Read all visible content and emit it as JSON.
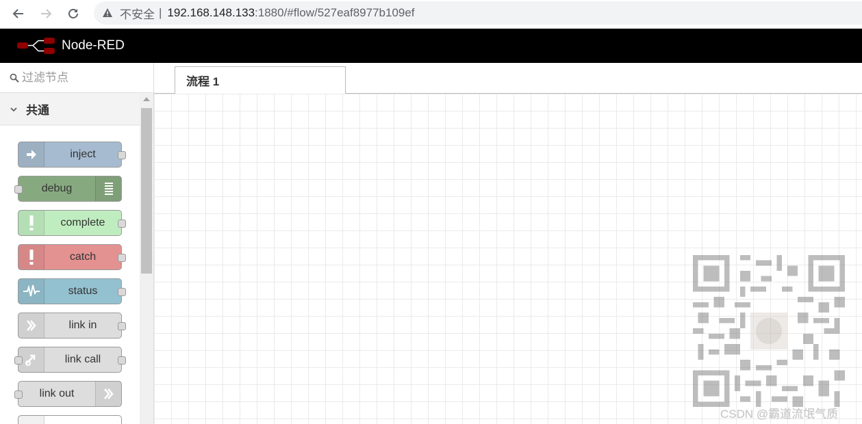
{
  "browser": {
    "insecure_label": "不安全",
    "separator": "|",
    "url_host": "192.168.148.133",
    "url_rest": ":1880/#flow/527eaf8977b109ef"
  },
  "header": {
    "title": "Node-RED"
  },
  "palette": {
    "search_placeholder": "过滤节点",
    "category": "共通",
    "nodes": [
      {
        "label": "inject",
        "color": "#a6bbcf",
        "icon": "inject-arrow-icon"
      },
      {
        "label": "debug",
        "color": "#87a980",
        "icon": "debug-list-icon"
      },
      {
        "label": "complete",
        "color": "#c0edc0",
        "icon": "exclamation-icon"
      },
      {
        "label": "catch",
        "color": "#e49191",
        "icon": "exclamation-icon"
      },
      {
        "label": "status",
        "color": "#94c1d0",
        "icon": "pulse-icon"
      },
      {
        "label": "link in",
        "color": "#dddddd",
        "icon": "link-in-icon"
      },
      {
        "label": "link call",
        "color": "#dddddd",
        "icon": "link-call-icon"
      },
      {
        "label": "link out",
        "color": "#dddddd",
        "icon": "link-out-icon"
      }
    ]
  },
  "workspace": {
    "tabs": [
      {
        "label": "流程 1"
      }
    ]
  },
  "watermark": {
    "text": "CSDN @霸道流氓气质"
  }
}
